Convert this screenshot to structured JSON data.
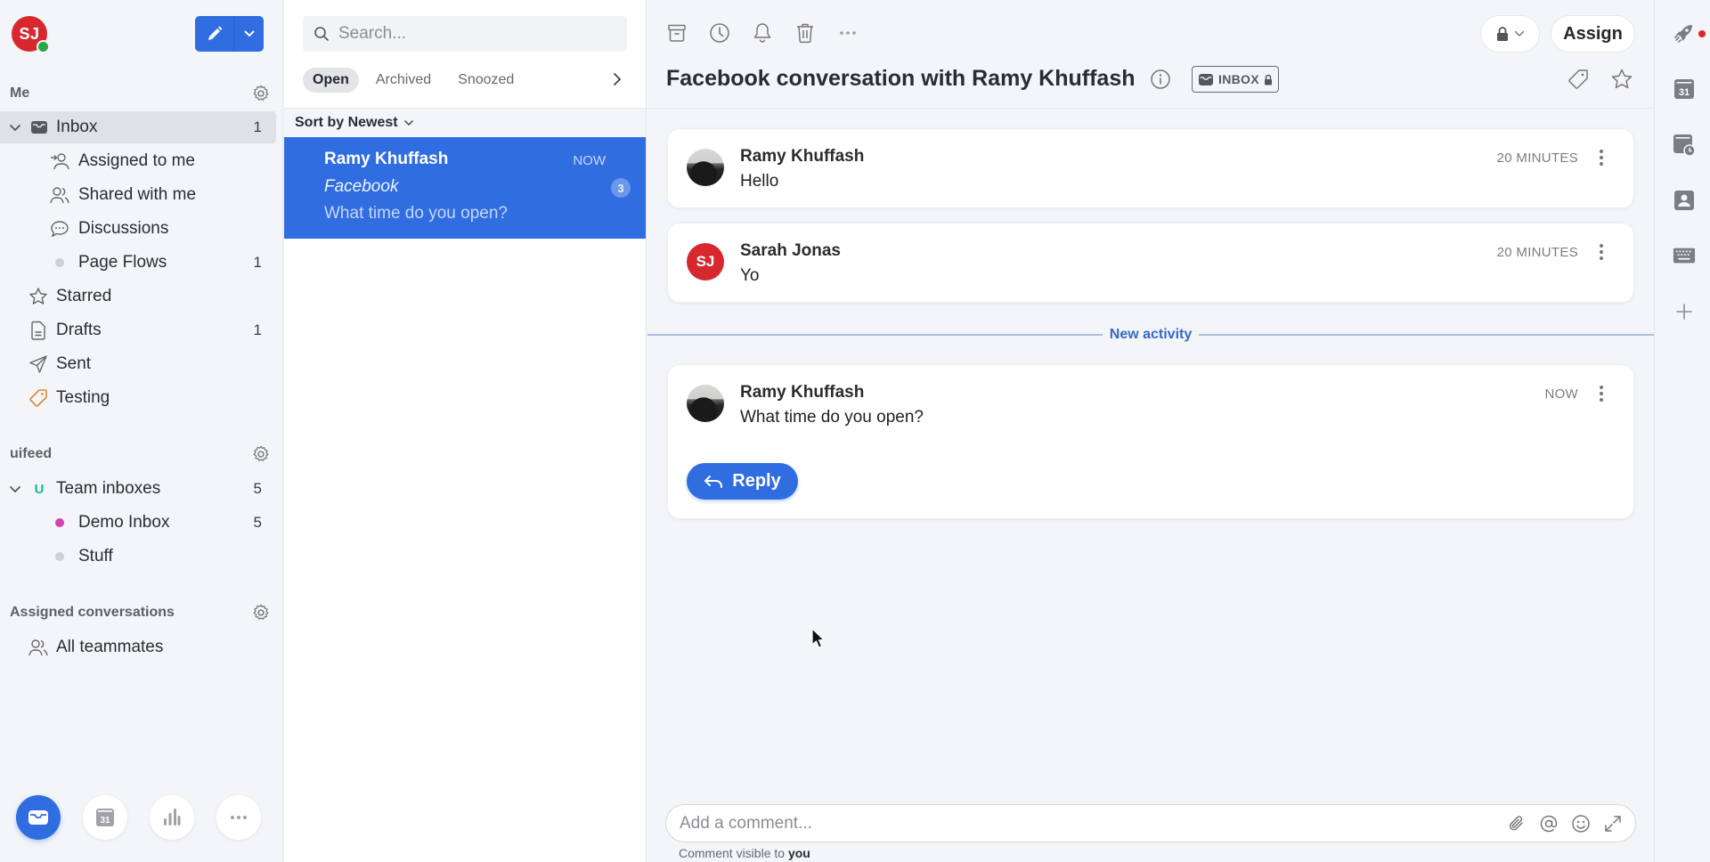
{
  "user": {
    "initials": "SJ",
    "status": "online"
  },
  "colors": {
    "accent": "#2f6de1",
    "avatar_red": "#d7282f",
    "online_green": "#28a745",
    "demo_inbox_dot": "#d63fb0",
    "stuff_dot": "#cfd0d4",
    "page_flows_dot": "#cfd0d4",
    "testing_tag": "#e0883a",
    "team_badge": "#17b3a3",
    "new_activity": "#3369c9"
  },
  "sidebar": {
    "me_section": {
      "title": "Me",
      "items": [
        {
          "label": "Inbox",
          "icon": "inbox-icon",
          "count": "1",
          "active": true,
          "expanded": true
        },
        {
          "label": "Assigned to me",
          "icon": "assigned-icon",
          "count": ""
        },
        {
          "label": "Shared with me",
          "icon": "shared-icon",
          "count": ""
        },
        {
          "label": "Discussions",
          "icon": "discussions-icon",
          "count": ""
        },
        {
          "label": "Page Flows",
          "icon": "dot",
          "count": "1"
        },
        {
          "label": "Starred",
          "icon": "star-icon",
          "count": ""
        },
        {
          "label": "Drafts",
          "icon": "draft-icon",
          "count": "1"
        },
        {
          "label": "Sent",
          "icon": "sent-icon",
          "count": ""
        },
        {
          "label": "Testing",
          "icon": "tag-icon",
          "count": ""
        }
      ]
    },
    "team_section": {
      "title": "uifeed",
      "team_badge": "U",
      "items": [
        {
          "label": "Team inboxes",
          "count": "5",
          "expanded": true
        },
        {
          "label": "Demo Inbox",
          "count": "5"
        },
        {
          "label": "Stuff",
          "count": ""
        }
      ]
    },
    "assigned_section": {
      "title": "Assigned conversations",
      "items": [
        {
          "label": "All teammates"
        }
      ]
    },
    "bottom": {
      "calendar_day": "31"
    }
  },
  "list": {
    "search_placeholder": "Search...",
    "tabs": [
      {
        "label": "Open",
        "active": true
      },
      {
        "label": "Archived"
      },
      {
        "label": "Snoozed"
      }
    ],
    "sort_label": "Sort by Newest",
    "conversations": [
      {
        "name": "Ramy Khuffash",
        "time": "NOW",
        "subject": "Facebook",
        "preview": "What time do you open?",
        "count": "3",
        "selected": true
      }
    ]
  },
  "conversation": {
    "title": "Facebook conversation with Ramy Khuffash",
    "inbox_chip": "INBOX",
    "assign_label": "Assign",
    "messages": [
      {
        "author": "Ramy Khuffash",
        "body": "Hello",
        "time": "20 MINUTES",
        "avatar": "photo"
      },
      {
        "author": "Sarah Jonas",
        "initials": "SJ",
        "body": "Yo",
        "time": "20 MINUTES",
        "avatar": "initials"
      }
    ],
    "new_activity_label": "New activity",
    "latest": {
      "author": "Ramy Khuffash",
      "body": "What time do you open?",
      "time": "NOW",
      "avatar": "photo"
    },
    "reply_label": "Reply",
    "comment_placeholder": "Add a comment...",
    "comment_note_prefix": "Comment visible to",
    "comment_note_who": "you"
  },
  "rail": {
    "calendar_day": "31",
    "notification": true
  }
}
